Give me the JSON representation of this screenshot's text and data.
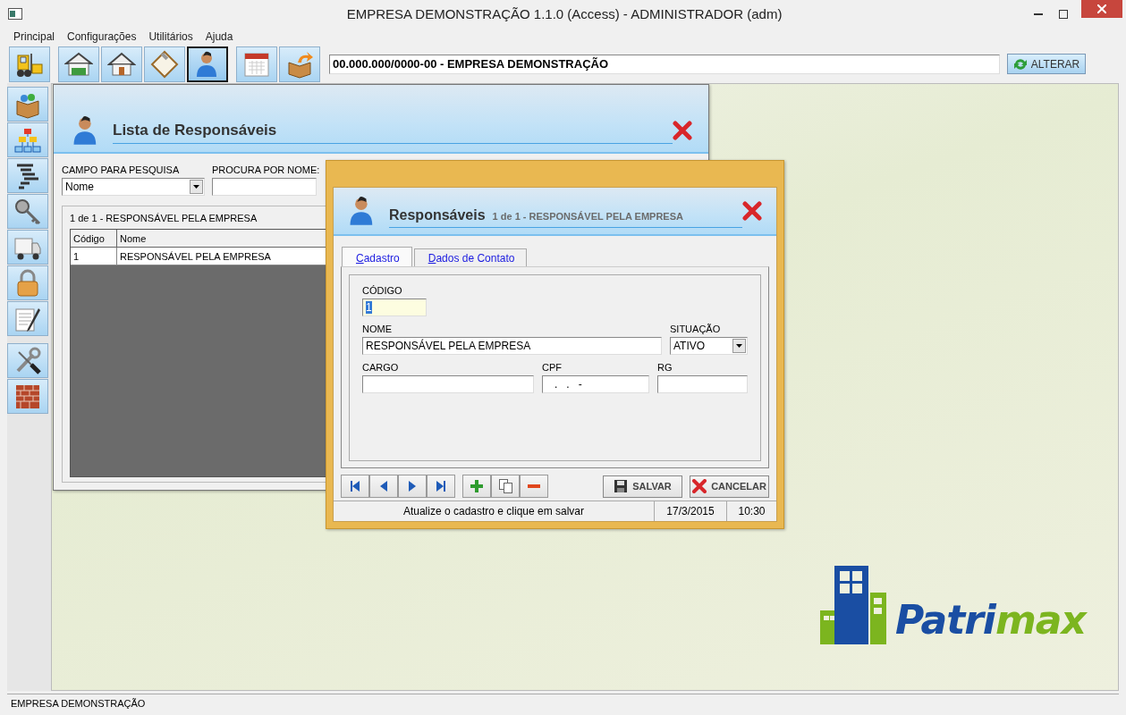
{
  "window": {
    "title": "EMPRESA DEMONSTRAÇÃO 1.1.0 (Access) - ADMINISTRADOR (adm)"
  },
  "menu": [
    "Principal",
    "Configurações",
    "Utilitários",
    "Ajuda"
  ],
  "toolbar": {
    "groups": [
      [
        {
          "kind": "forklift",
          "selected": false
        }
      ],
      [
        {
          "kind": "warehouse",
          "selected": false
        },
        {
          "kind": "house",
          "selected": false
        },
        {
          "kind": "clipboard",
          "selected": false
        },
        {
          "kind": "person",
          "selected": true
        }
      ],
      [
        {
          "kind": "calendar",
          "selected": false
        },
        {
          "kind": "box-arrow",
          "selected": false
        }
      ]
    ],
    "company_field": {
      "value": "00.000.000/0000-00 - EMPRESA DEMONSTRAÇÃO"
    },
    "alterar_button": "ALTERAR"
  },
  "sidebar": {
    "groups": [
      [
        {
          "kind": "box"
        },
        {
          "kind": "org-chart"
        },
        {
          "kind": "bars"
        },
        {
          "kind": "key"
        },
        {
          "kind": "truck"
        },
        {
          "kind": "padlock"
        },
        {
          "kind": "document-pen"
        }
      ],
      [
        {
          "kind": "tools"
        },
        {
          "kind": "bricks"
        }
      ]
    ]
  },
  "list_window": {
    "title": "Lista de Responsáveis",
    "search_field_label": "CAMPO PARA PESQUISA",
    "search_field_value": "Nome",
    "name_search_label": "PROCURA POR NOME:",
    "caption": "1 de 1 - RESPONSÁVEL PELA EMPRESA",
    "table": {
      "columns": [
        "Código",
        "Nome"
      ],
      "rows": [
        [
          "1",
          "RESPONSÁVEL PELA EMPRESA"
        ]
      ]
    }
  },
  "dialog": {
    "title": "Responsáveis",
    "subtitle": "1 de 1 - RESPONSÁVEL PELA EMPRESA",
    "tabs": [
      {
        "label": "Cadastro",
        "selected": true
      },
      {
        "label": "Dados de Contato",
        "selected": false
      }
    ],
    "field_rows": [
      [
        {
          "label": "CÓDIGO",
          "value": "1",
          "kind": "text",
          "highlighted": true
        }
      ],
      [
        {
          "label": "NOME",
          "value": "RESPONSÁVEL PELA EMPRESA",
          "kind": "text"
        },
        {
          "label": "SITUAÇÃO",
          "value": "ATIVO",
          "kind": "select"
        }
      ],
      [
        {
          "label": "CARGO",
          "kind": "text"
        },
        {
          "label": "CPF",
          "value": "   .   .   -",
          "kind": "text"
        },
        {
          "label": "RG",
          "kind": "text"
        }
      ]
    ],
    "record_buttons": [
      [
        {
          "kind": "first"
        },
        {
          "kind": "prev"
        },
        {
          "kind": "next"
        },
        {
          "kind": "last"
        }
      ],
      [
        {
          "kind": "add"
        },
        {
          "kind": "copy"
        },
        {
          "kind": "remove"
        }
      ]
    ],
    "save_button": "SALVAR",
    "cancel_button": "CANCELAR",
    "status": {
      "message": "Atualize o cadastro e clique em salvar",
      "date": "17/3/2015",
      "time": "10:30"
    }
  },
  "logo": {
    "parts": [
      {
        "text": "Patri",
        "color": "#1a4ea3"
      },
      {
        "text": "max",
        "color": "#7cb51f"
      }
    ]
  },
  "status_bar": "EMPRESA DEMONSTRAÇÃO"
}
